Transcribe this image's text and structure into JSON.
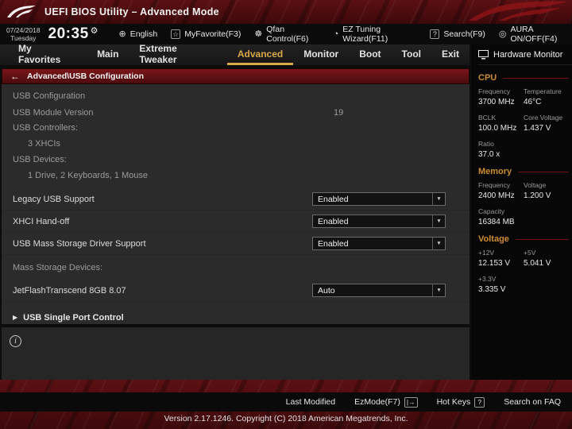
{
  "titlebar": {
    "title": "UEFI BIOS Utility – Advanced Mode"
  },
  "infobar": {
    "date": "07/24/2018",
    "day": "Tuesday",
    "time": "20:35",
    "items": [
      {
        "id": "english",
        "icon": "globe-icon",
        "boxed": false,
        "label": "English"
      },
      {
        "id": "myfavorite",
        "icon": "star-icon",
        "boxed": true,
        "label": "MyFavorite(F3)"
      },
      {
        "id": "qfan",
        "icon": "fan-icon",
        "boxed": false,
        "label": "Qfan Control(F6)"
      },
      {
        "id": "ez-tuning",
        "icon": "wizard-icon",
        "boxed": false,
        "label": "EZ Tuning Wizard(F11)"
      },
      {
        "id": "search",
        "icon": "question-icon",
        "boxed": true,
        "label": "Search(F9)"
      },
      {
        "id": "aura",
        "icon": "aura-icon",
        "boxed": false,
        "label": "AURA ON/OFF(F4)"
      }
    ]
  },
  "tabs": [
    {
      "label": "My Favorites",
      "active": false
    },
    {
      "label": "Main",
      "active": false
    },
    {
      "label": "Extreme Tweaker",
      "active": false
    },
    {
      "label": "Advanced",
      "active": true
    },
    {
      "label": "Monitor",
      "active": false
    },
    {
      "label": "Boot",
      "active": false
    },
    {
      "label": "Tool",
      "active": false
    },
    {
      "label": "Exit",
      "active": false
    }
  ],
  "breadcrumb": {
    "back": "←",
    "path": "Advanced\\USB Configuration"
  },
  "content": {
    "rows": [
      {
        "type": "header",
        "label": "USB Configuration"
      },
      {
        "type": "static",
        "label": "USB Module Version",
        "value": "19"
      },
      {
        "type": "static",
        "label": "USB Controllers:"
      },
      {
        "type": "indent",
        "label": "3 XHCIs"
      },
      {
        "type": "static",
        "label": "USB Devices:"
      },
      {
        "type": "indent",
        "label": "1 Drive, 2 Keyboards, 1 Mouse"
      },
      {
        "type": "dropdown",
        "label": "Legacy USB Support",
        "value": "Enabled",
        "gap": true
      },
      {
        "type": "dropdown",
        "label": "XHCI Hand-off",
        "value": "Enabled"
      },
      {
        "type": "dropdown",
        "label": "USB Mass Storage Driver Support",
        "value": "Enabled"
      },
      {
        "type": "static",
        "label": "Mass Storage Devices:",
        "gap": true
      },
      {
        "type": "dropdown",
        "label": "JetFlashTranscend 8GB 8.07",
        "value": "Auto",
        "gap": true
      },
      {
        "type": "submenu",
        "label": "USB Single Port Control",
        "gap": true
      }
    ]
  },
  "hardware_monitor": {
    "title": "Hardware Monitor",
    "sections": [
      {
        "title": "CPU",
        "entries": [
          {
            "label": "Frequency",
            "value": "3700 MHz"
          },
          {
            "label": "Temperature",
            "value": "46°C"
          },
          {
            "label": "BCLK",
            "value": "100.0 MHz"
          },
          {
            "label": "Core Voltage",
            "value": "1.437 V"
          },
          {
            "label": "Ratio",
            "value": "37.0 x"
          }
        ]
      },
      {
        "title": "Memory",
        "entries": [
          {
            "label": "Frequency",
            "value": "2400 MHz"
          },
          {
            "label": "Voltage",
            "value": "1.200 V"
          },
          {
            "label": "Capacity",
            "value": "16384 MB"
          }
        ]
      },
      {
        "title": "Voltage",
        "entries": [
          {
            "label": "+12V",
            "value": "12.153 V"
          },
          {
            "label": "+5V",
            "value": "5.041 V"
          },
          {
            "label": "+3.3V",
            "value": "3.335 V"
          }
        ]
      }
    ]
  },
  "footer": {
    "last_modified": "Last Modified",
    "ezmode": "EzMode(F7)",
    "ezmode_icon_glyph": "|→",
    "hotkeys": "Hot Keys",
    "hotkeys_badge": "?",
    "search_faq": "Search on FAQ",
    "version": "Version 2.17.1246. Copyright (C) 2018 American Megatrends, Inc."
  },
  "colors": {
    "accent_gold": "#d9a84a",
    "maroon": "#5a1013",
    "section_orange": "#cc8b33",
    "content_bg": "#2b2b2b"
  }
}
